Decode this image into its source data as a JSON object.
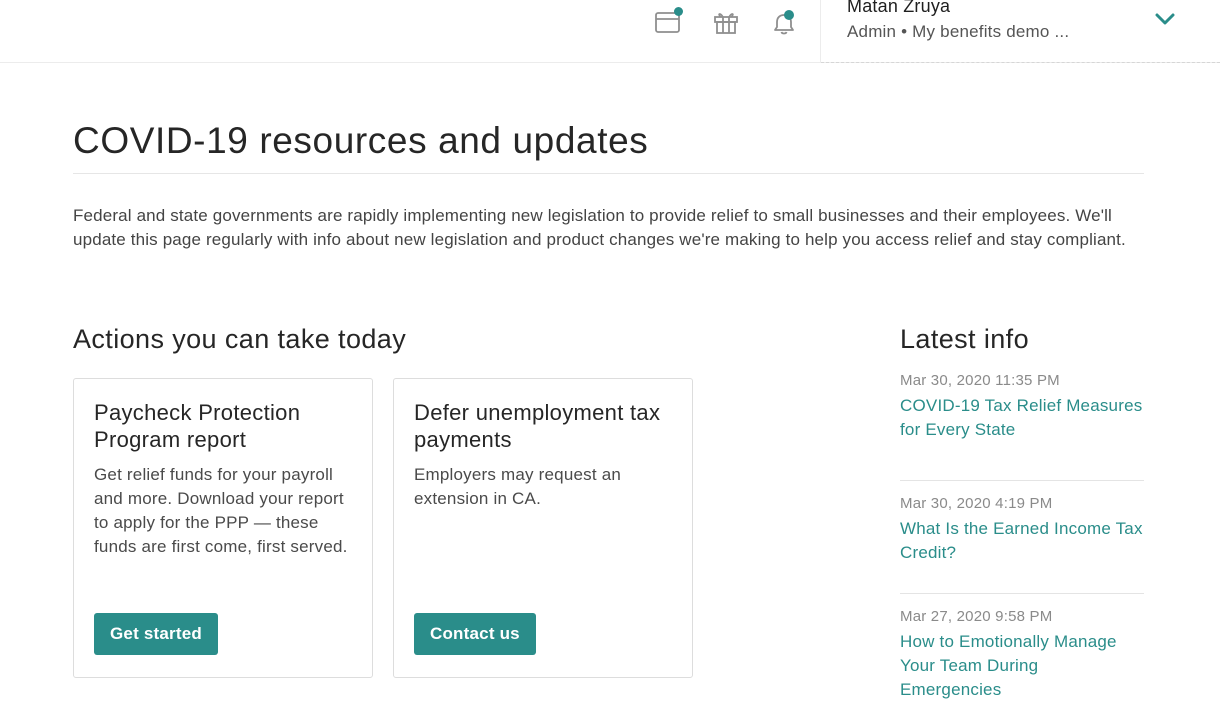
{
  "header": {
    "user_name": "Matan Zruya",
    "user_subtitle": "Admin • My benefits demo ...",
    "icons": [
      "calendar-icon",
      "gift-icon",
      "bell-icon",
      "chevron-down-icon"
    ],
    "accent_color": "#2a8d8a"
  },
  "page": {
    "title": "COVID-19 resources and updates",
    "intro": "Federal and state governments are rapidly implementing new legislation to provide relief to small businesses and their employees. We'll update this page regularly with info about new legislation and product changes we're making to help you access relief and stay compliant."
  },
  "actions": {
    "heading": "Actions you can take today",
    "cards": [
      {
        "title": "Paycheck Protection Program report",
        "description": "Get relief funds for your payroll and more. Download your report to apply for the PPP — these funds are first come, first served.",
        "button_label": "Get started"
      },
      {
        "title": "Defer unemployment tax payments",
        "description": "Employers may request an extension in CA.",
        "button_label": "Contact us"
      }
    ]
  },
  "latest": {
    "heading": "Latest info",
    "items": [
      {
        "date": "Mar 30, 2020 11:35 PM",
        "title": "COVID-19 Tax Relief Measures for Every State"
      },
      {
        "date": "Mar 30, 2020 4:19 PM",
        "title": "What Is the Earned Income Tax Credit?"
      },
      {
        "date": "Mar 27, 2020 9:58 PM",
        "title": "How to Emotionally Manage Your Team During Emergencies"
      }
    ]
  }
}
